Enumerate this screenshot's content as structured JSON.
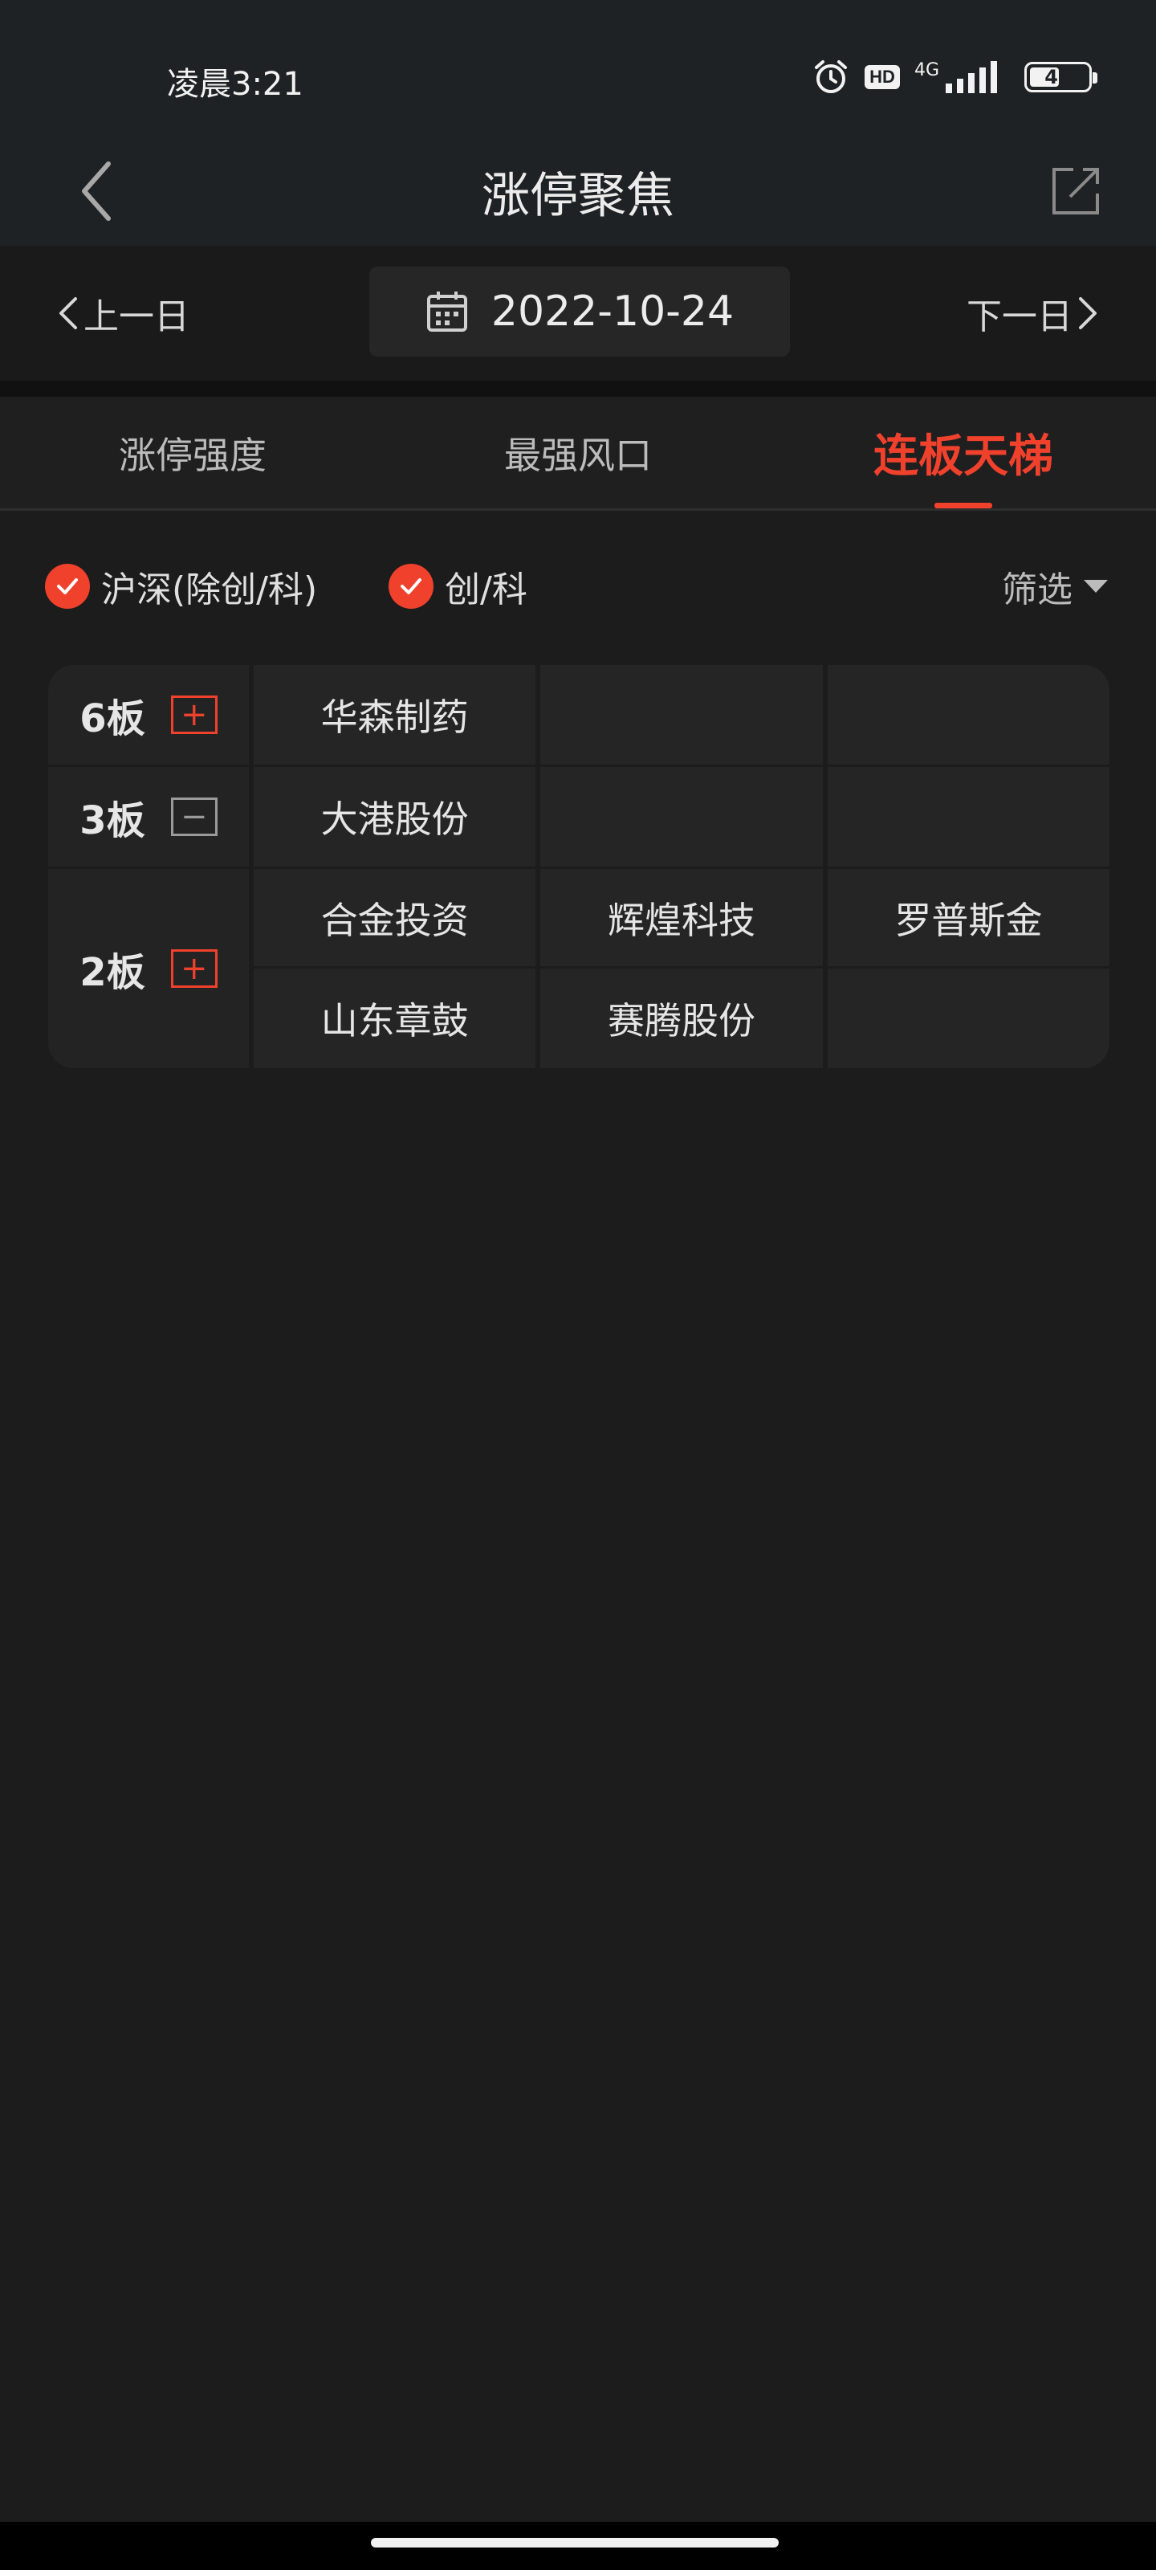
{
  "status_bar": {
    "time": "凌晨3:21",
    "hd": "HD",
    "network": "4G",
    "battery": "45"
  },
  "header": {
    "title": "涨停聚焦"
  },
  "date_nav": {
    "prev_label": "上一日",
    "date": "2022-10-24",
    "next_label": "下一日"
  },
  "tabs": [
    {
      "label": "涨停强度",
      "active": false
    },
    {
      "label": "最强风口",
      "active": false
    },
    {
      "label": "连板天梯",
      "active": true
    }
  ],
  "filters": {
    "options": [
      {
        "label": "沪深(除创/科)",
        "checked": true
      },
      {
        "label": "创/科",
        "checked": true
      }
    ],
    "filter_label": "筛选"
  },
  "ladder": [
    {
      "board": "6板",
      "toggle": "+",
      "rows": [
        [
          "华森制药",
          "",
          ""
        ]
      ]
    },
    {
      "board": "3板",
      "toggle": "−",
      "rows": [
        [
          "大港股份",
          "",
          ""
        ]
      ]
    },
    {
      "board": "2板",
      "toggle": "+",
      "rows": [
        [
          "合金投资",
          "辉煌科技",
          "罗普斯金"
        ],
        [
          "山东章鼓",
          "赛腾股份",
          ""
        ]
      ]
    }
  ],
  "colors": {
    "accent": "#f0412d",
    "background": "#1c1c1c"
  }
}
